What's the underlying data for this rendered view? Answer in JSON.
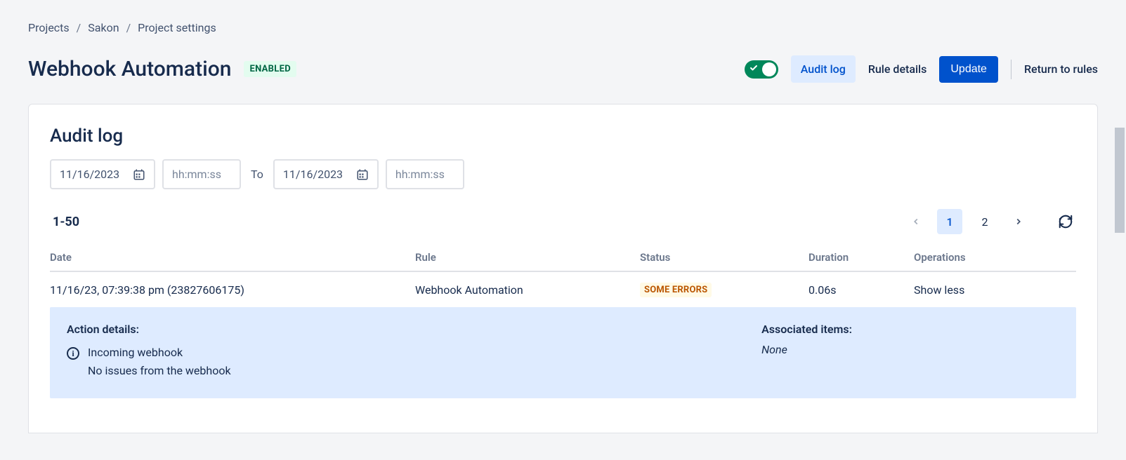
{
  "breadcrumb": {
    "items": [
      "Projects",
      "Sakon",
      "Project settings"
    ]
  },
  "header": {
    "title": "Webhook Automation",
    "badge": "ENABLED",
    "audit_log_btn": "Audit log",
    "rule_details_btn": "Rule details",
    "update_btn": "Update",
    "return_btn": "Return to rules"
  },
  "card": {
    "title": "Audit log",
    "filter": {
      "from_date": "11/16/2023",
      "from_time_placeholder": "hh:mm:ss",
      "to_label": "To",
      "to_date": "11/16/2023",
      "to_time_placeholder": "hh:mm:ss"
    },
    "range": "1-50",
    "pages": {
      "p1": "1",
      "p2": "2"
    },
    "columns": {
      "date": "Date",
      "rule": "Rule",
      "status": "Status",
      "duration": "Duration",
      "operations": "Operations"
    },
    "row": {
      "date": "11/16/23, 07:39:38 pm (23827606175)",
      "rule": "Webhook Automation",
      "status": "SOME ERRORS",
      "duration": "0.06s",
      "ops": "Show less"
    },
    "details": {
      "title": "Action details:",
      "line1": "Incoming webhook",
      "line2": "No issues from the webhook",
      "assoc_title": "Associated items:",
      "assoc_value": "None"
    }
  }
}
